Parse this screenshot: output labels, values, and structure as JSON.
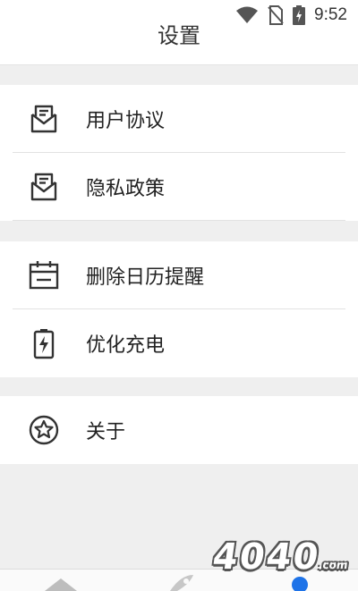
{
  "status": {
    "time": "9:52"
  },
  "header": {
    "title": "设置"
  },
  "groups": [
    [
      {
        "label": "用户协议",
        "icon": "mail-icon"
      },
      {
        "label": "隐私政策",
        "icon": "mail-icon"
      }
    ],
    [
      {
        "label": "删除日历提醒",
        "icon": "calendar-icon"
      },
      {
        "label": "优化充电",
        "icon": "battery-charging-icon"
      }
    ],
    [
      {
        "label": "关于",
        "icon": "star-circle-icon"
      }
    ]
  ],
  "watermark": {
    "text": "4040",
    "suffix": ".com"
  },
  "colors": {
    "background": "#efefef",
    "accent": "#1e73e8"
  }
}
